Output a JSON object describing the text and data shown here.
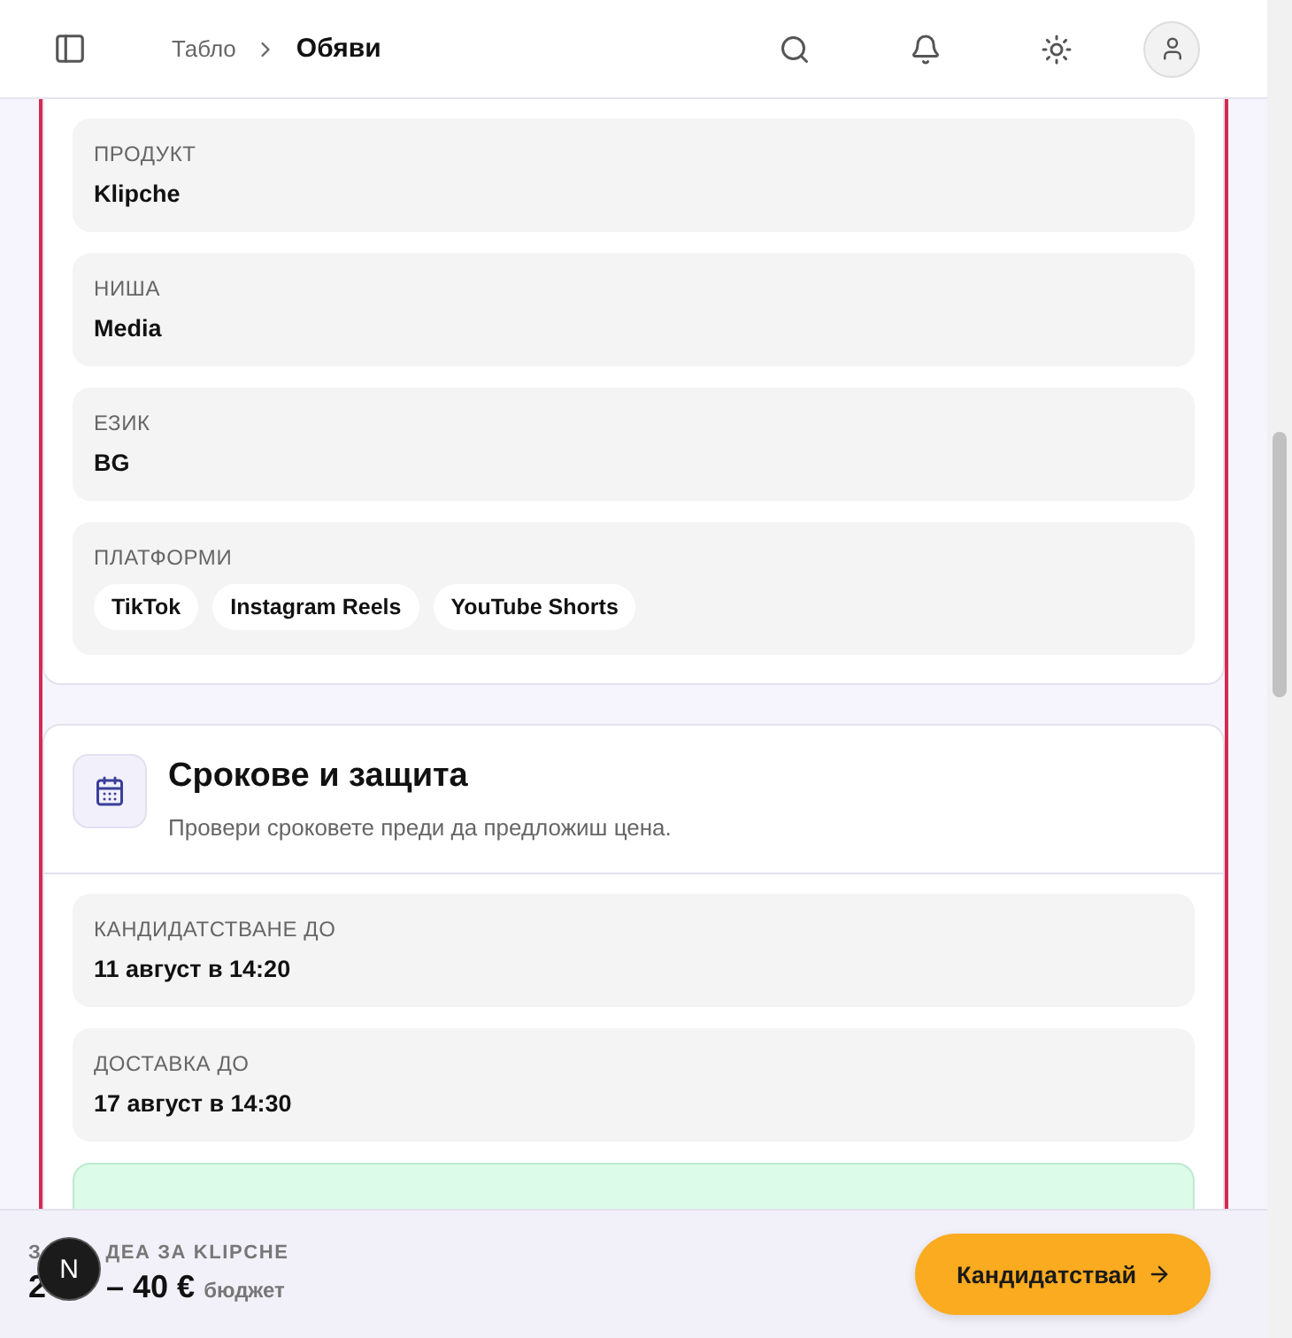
{
  "header": {
    "breadcrumb": [
      {
        "label": "Табло",
        "current": false
      },
      {
        "label": "Обяви",
        "current": true
      }
    ]
  },
  "details_card": {
    "fields": [
      {
        "kind": "text",
        "label": "ПРОДУКТ",
        "value": "Klipche"
      },
      {
        "kind": "text",
        "label": "НИША",
        "value": "Media"
      },
      {
        "kind": "text",
        "label": "ЕЗИК",
        "value": "BG"
      },
      {
        "kind": "tags",
        "label": "ПЛАТФОРМИ",
        "tags": [
          "TikTok",
          "Instagram Reels",
          "YouTube Shorts"
        ]
      }
    ]
  },
  "terms_card": {
    "title": "Срокове и защита",
    "subtitle": "Провери сроковете преди да предложиш цена.",
    "fields": [
      {
        "kind": "text",
        "label": "КАНДИДАТСТВАНЕ ДО",
        "value": "11 август в 14:20"
      },
      {
        "kind": "text",
        "label": "ДОСТАВКА ДО",
        "value": "17 август в 14:30"
      },
      {
        "kind": "success"
      }
    ]
  },
  "footer": {
    "label_parts": [
      "З",
      "ДЕА ЗА KLIPCHE"
    ],
    "price_parts": [
      "2",
      "– 40 €"
    ],
    "price_unit": "бюджет",
    "badge": "N",
    "button": "Кандидатствай"
  }
}
